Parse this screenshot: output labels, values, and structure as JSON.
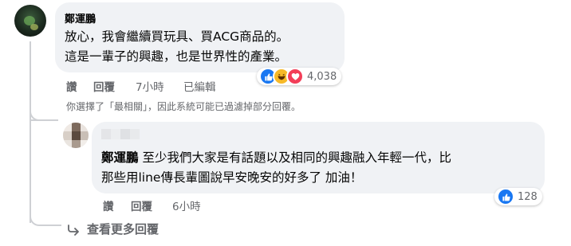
{
  "main_comment": {
    "author": "鄭運鵬",
    "lines": [
      "放心，我會繼續買玩具、買ACG商品的。",
      "這是一輩子的興趣，也是世界性的產業。"
    ],
    "actions": {
      "like": "讚",
      "reply": "回覆",
      "time": "7小時",
      "edited": "已編輯"
    },
    "reactions": {
      "icons": [
        "like-icon",
        "haha-icon",
        "love-icon"
      ],
      "count": "4,038"
    },
    "filter_notice": "你選擇了「最相關」，因此系統可能已過濾掉部分回覆。"
  },
  "reply": {
    "author_tag": "鄭運鵬",
    "line1_rest": "至少我們大家是有話題以及相同的興趣融入年輕一代，比",
    "line2": "那些用line傳長輩圖說早安晚安的好多了 加油！",
    "actions": {
      "like": "讚",
      "reply": "回覆",
      "time": "6小時"
    },
    "reactions": {
      "icons": [
        "like-icon"
      ],
      "count": "128"
    }
  },
  "view_more": {
    "label": "查看更多回覆",
    "icon": "reply-arrow-icon"
  },
  "colors": {
    "bubble": "#f0f2f5",
    "secondary_text": "#65676b",
    "like_blue": "#1877f2",
    "haha_yellow": "#f7b928",
    "love_red": "#f33e58"
  }
}
